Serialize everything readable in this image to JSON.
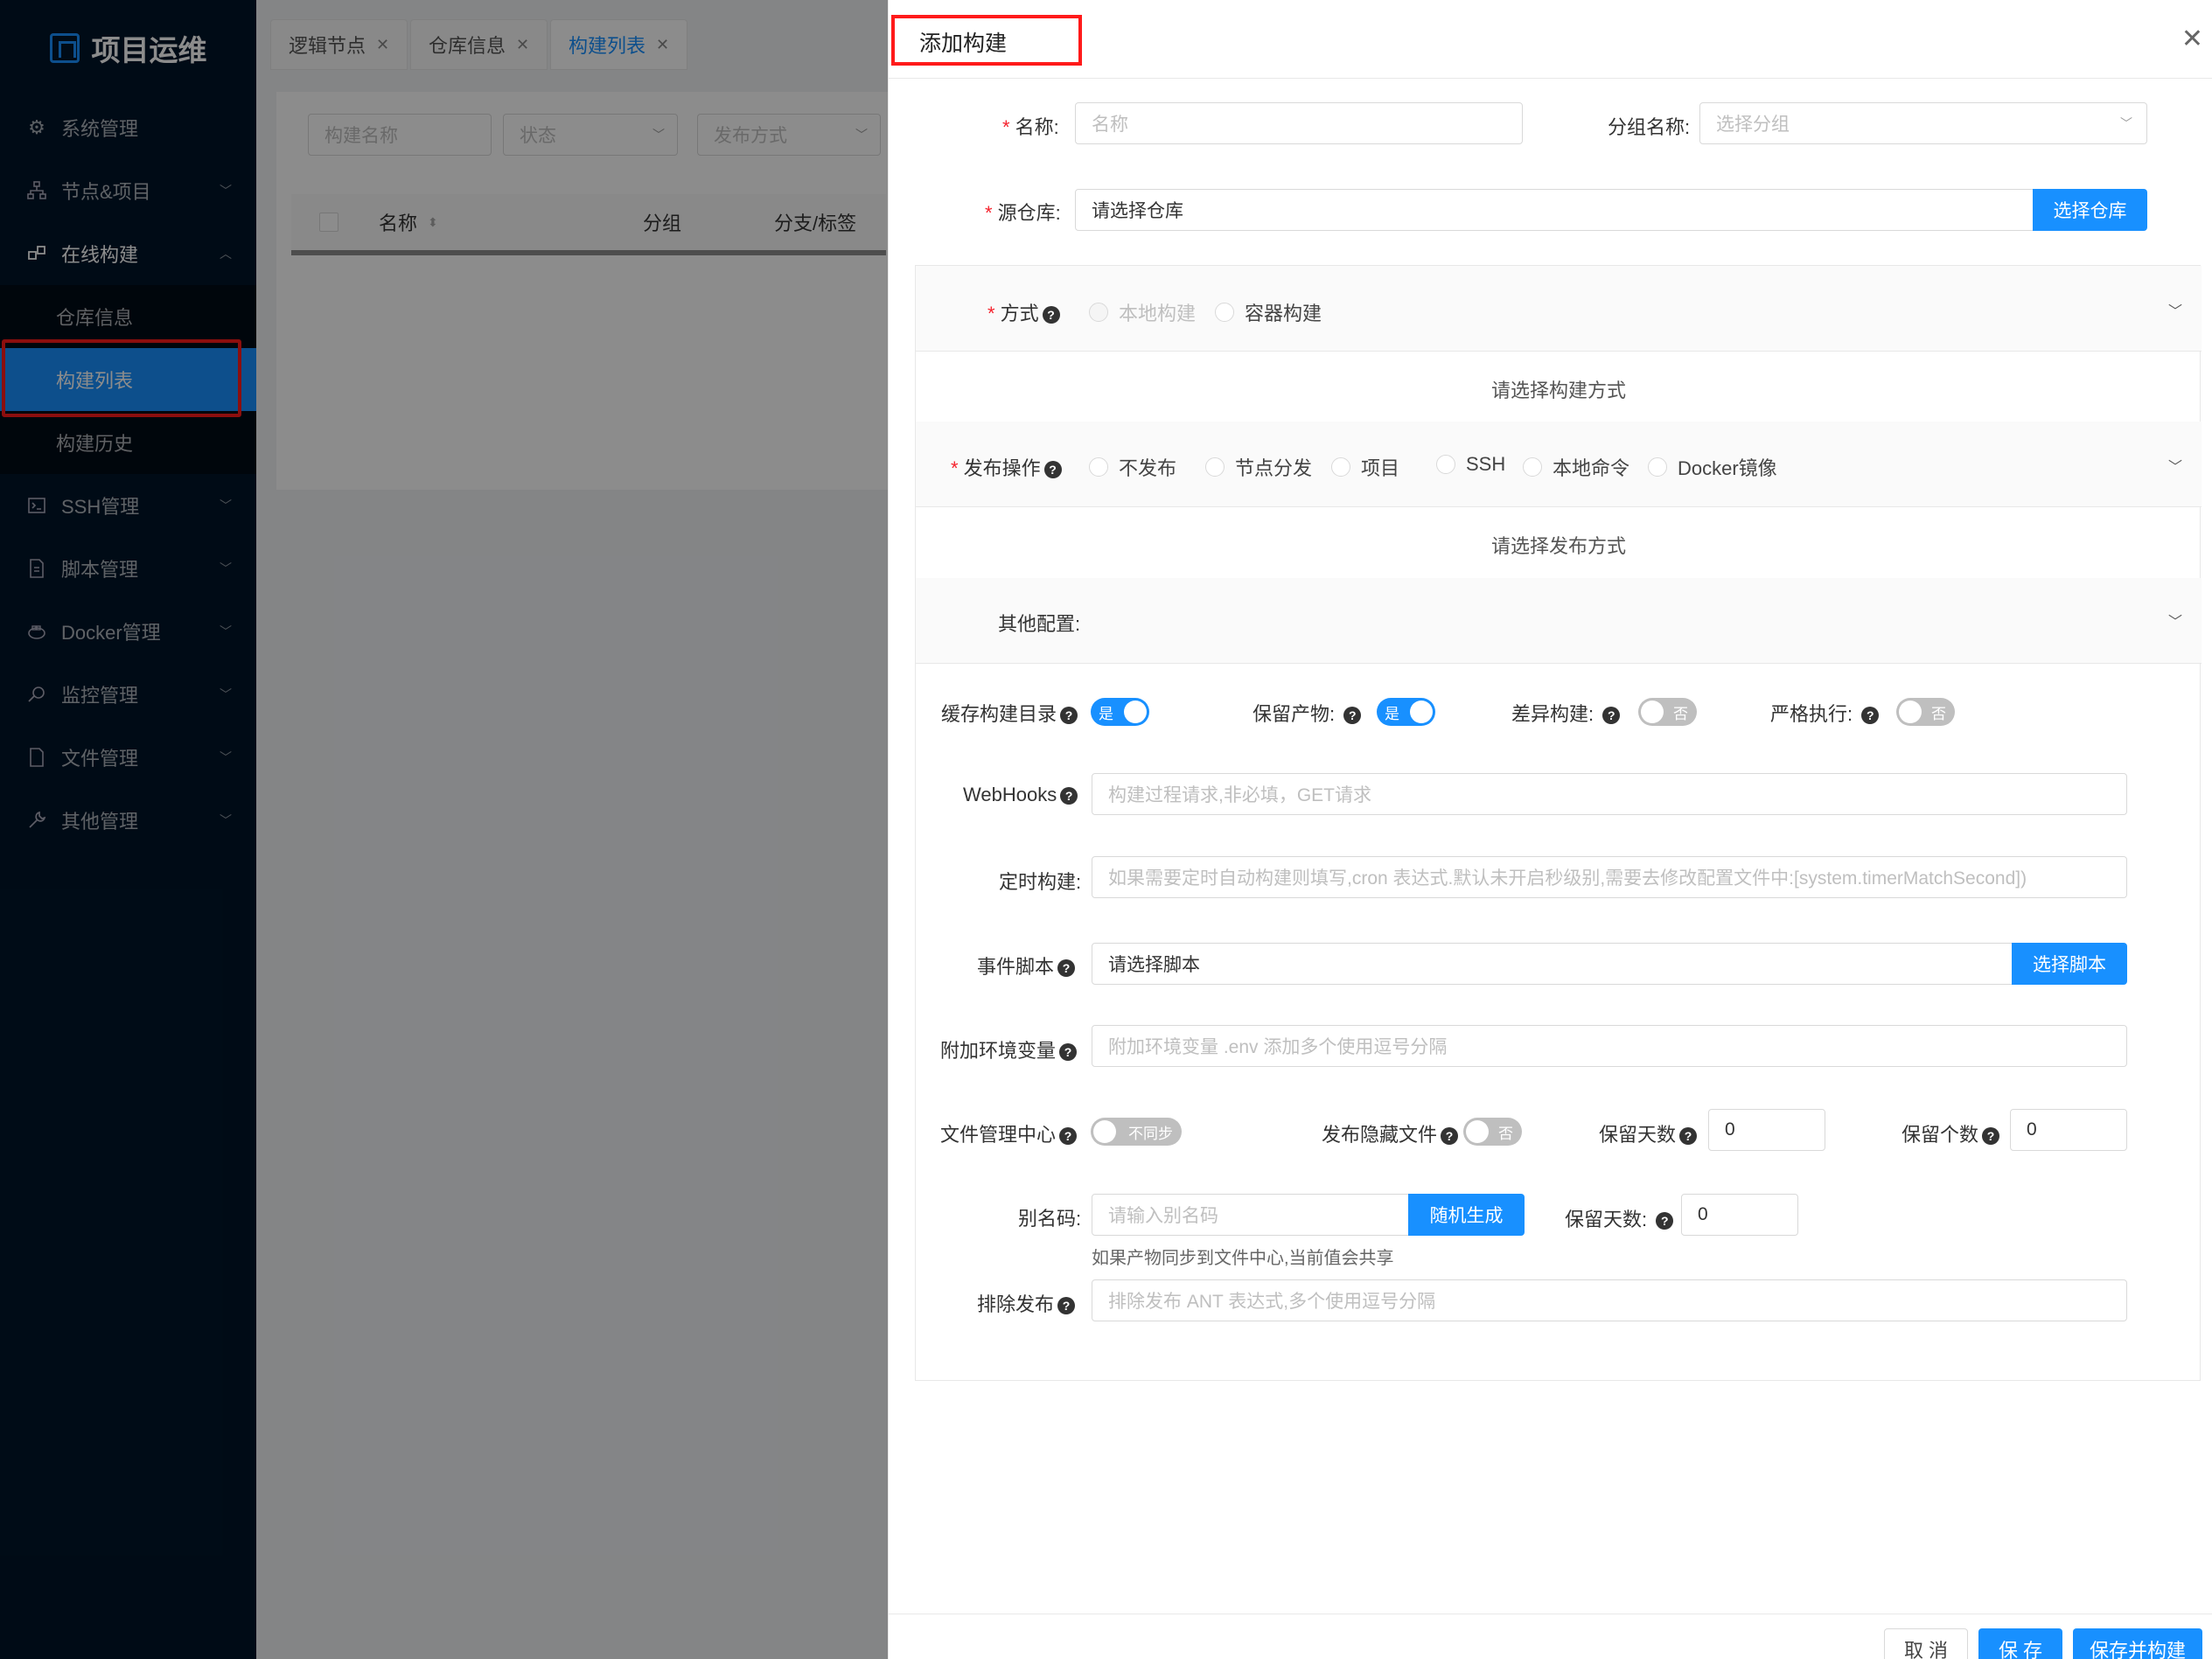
{
  "app": {
    "title": "项目运维"
  },
  "sidebar": {
    "items": [
      {
        "label": "系统管理",
        "icon": "gear-icon"
      },
      {
        "label": "节点&项目",
        "icon": "sitemap-icon"
      },
      {
        "label": "在线构建",
        "icon": "build-icon"
      },
      {
        "label": "SSH管理",
        "icon": "terminal-icon"
      },
      {
        "label": "脚本管理",
        "icon": "file-code-icon"
      },
      {
        "label": "Docker管理",
        "icon": "docker-icon"
      },
      {
        "label": "监控管理",
        "icon": "monitor-icon"
      },
      {
        "label": "文件管理",
        "icon": "file-icon"
      },
      {
        "label": "其他管理",
        "icon": "wrench-icon"
      }
    ],
    "submenu": [
      "仓库信息",
      "构建列表",
      "构建历史"
    ]
  },
  "tabs": [
    "逻辑节点",
    "仓库信息",
    "构建列表"
  ],
  "filters": {
    "name_placeholder": "构建名称",
    "status_placeholder": "状态",
    "release_placeholder": "发布方式"
  },
  "table": {
    "columns": [
      "名称",
      "分组",
      "分支/标签"
    ]
  },
  "drawer": {
    "title": "添加构建",
    "name_label": "名称:",
    "name_placeholder": "名称",
    "group_label": "分组名称:",
    "group_placeholder": "选择分组",
    "repo_label": "源仓库:",
    "repo_value": "请选择仓库",
    "repo_button": "选择仓库",
    "method": {
      "label": "方式",
      "options": [
        "本地构建",
        "容器构建"
      ],
      "hint": "请选择构建方式"
    },
    "release": {
      "label": "发布操作",
      "options": [
        "不发布",
        "节点分发",
        "项目",
        "SSH",
        "本地命令",
        "Docker镜像"
      ],
      "hint": "请选择发布方式"
    },
    "other": {
      "label": "其他配置:"
    },
    "cache_label": "缓存构建目录",
    "keep_product_label": "保留产物:",
    "diff_label": "差异构建:",
    "strict_label": "严格执行:",
    "switch_on": "是",
    "switch_off": "否",
    "webhooks_label": "WebHooks",
    "webhooks_placeholder": "构建过程请求,非必填，GET请求",
    "cron_label": "定时构建:",
    "cron_placeholder": "如果需要定时自动构建则填写,cron 表达式.默认未开启秒级别,需要去修改配置文件中:[system.timerMatchSecond])",
    "script_label": "事件脚本",
    "script_value": "请选择脚本",
    "script_button": "选择脚本",
    "env_label": "附加环境变量",
    "env_placeholder": "附加环境变量  .env 添加多个使用逗号分隔",
    "file_center_label": "文件管理中心",
    "file_center_switch": "不同步",
    "hidden_files_label": "发布隐藏文件",
    "keep_days_label": "保留天数",
    "keep_days_value": "0",
    "keep_count_label": "保留个数",
    "keep_count_value": "0",
    "alias_label": "别名码:",
    "alias_placeholder": "请输入别名码",
    "alias_button": "随机生成",
    "alias_keep_days_label": "保留天数:",
    "alias_keep_days_value": "0",
    "alias_hint": "如果产物同步到文件中心,当前值会共享",
    "exclude_label": "排除发布",
    "exclude_placeholder": "排除发布 ANT 表达式,多个使用逗号分隔",
    "footer": {
      "cancel": "取 消",
      "save": "保 存",
      "save_build": "保存并构建"
    }
  },
  "colors": {
    "primary": "#1890ff",
    "sidebar": "#001529",
    "highlight_border": "#ff1a1a"
  }
}
